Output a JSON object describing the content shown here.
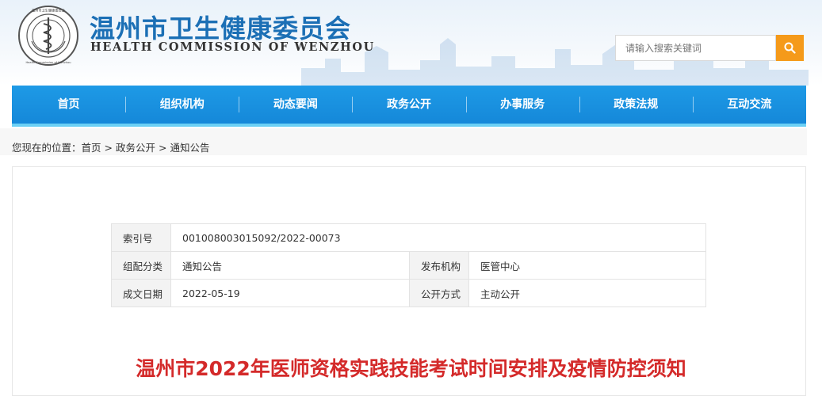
{
  "header": {
    "title_cn": "温州市卫生健康委员会",
    "title_en": "HEALTH COMMISSION OF WENZHOU",
    "emblem_text": "Health Commission of Wenzhou 温州市卫生健康委员会"
  },
  "search": {
    "placeholder": "请输入搜索关键词",
    "button_icon": "search-icon"
  },
  "nav": {
    "items": [
      "首页",
      "组织机构",
      "动态要闻",
      "政务公开",
      "办事服务",
      "政策法规",
      "互动交流"
    ]
  },
  "breadcrumb": {
    "prefix": "您现在的位置：",
    "items": [
      "首页",
      "政务公开",
      "通知公告"
    ],
    "separator": ">"
  },
  "meta": {
    "index_label": "索引号",
    "index_value": "001008003015092/2022-00073",
    "category_label": "组配分类",
    "category_value": "通知公告",
    "publisher_label": "发布机构",
    "publisher_value": "医管中心",
    "date_label": "成文日期",
    "date_value": "2022-05-19",
    "open_label": "公开方式",
    "open_value": "主动公开"
  },
  "article": {
    "title": "温州市2022年医师资格实践技能考试时间安排及疫情防控须知"
  },
  "colors": {
    "brand_blue": "#1b6fb5",
    "nav_blue": "#1588d9",
    "search_orange": "#f59a1a",
    "title_red": "#d42a2a"
  }
}
